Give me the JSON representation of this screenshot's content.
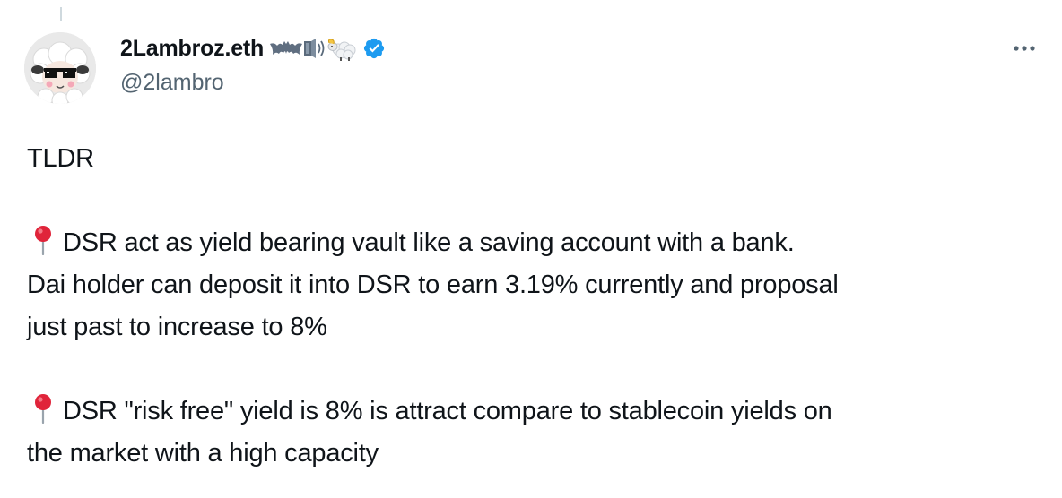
{
  "author": {
    "display_name": "2Lambroz.eth",
    "handle": "@2lambro",
    "name_emoji": [
      "bat-icon",
      "speaker-icon",
      "sheep-icon"
    ],
    "verified": true,
    "verified_color": "#1d9bf0"
  },
  "more_icon": "more-horizontal-icon",
  "tweet": {
    "line1": "TLDR",
    "bullet_icon": "round-pushpin-icon",
    "para1_line1": "DSR act as yield bearing vault like a saving account with a bank.",
    "para1_line2": "Dai holder can deposit it into DSR to earn 3.19% currently and proposal",
    "para1_line3": "just past to increase to 8%",
    "para2_line1": "DSR \"risk free\" yield is 8% is attract compare to stablecoin yields on",
    "para2_line2": "the market with a high capacity"
  }
}
